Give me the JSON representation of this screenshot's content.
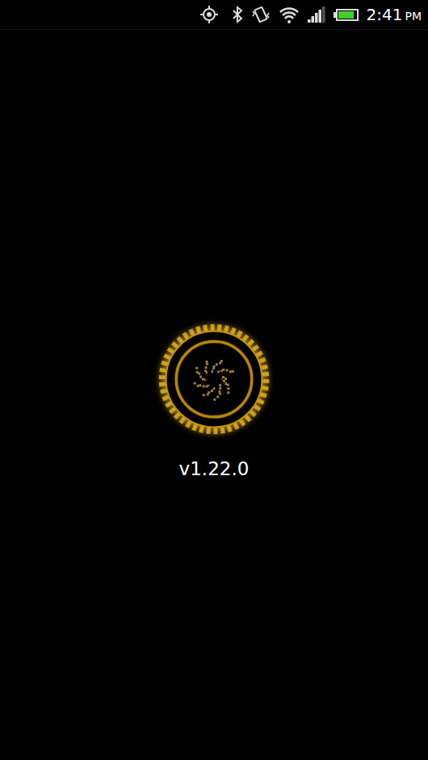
{
  "status_bar": {
    "time": "2:41",
    "ampm": "PM",
    "battery_level": 0.9,
    "signal_level": 0.8
  },
  "version": "v1.22.0"
}
